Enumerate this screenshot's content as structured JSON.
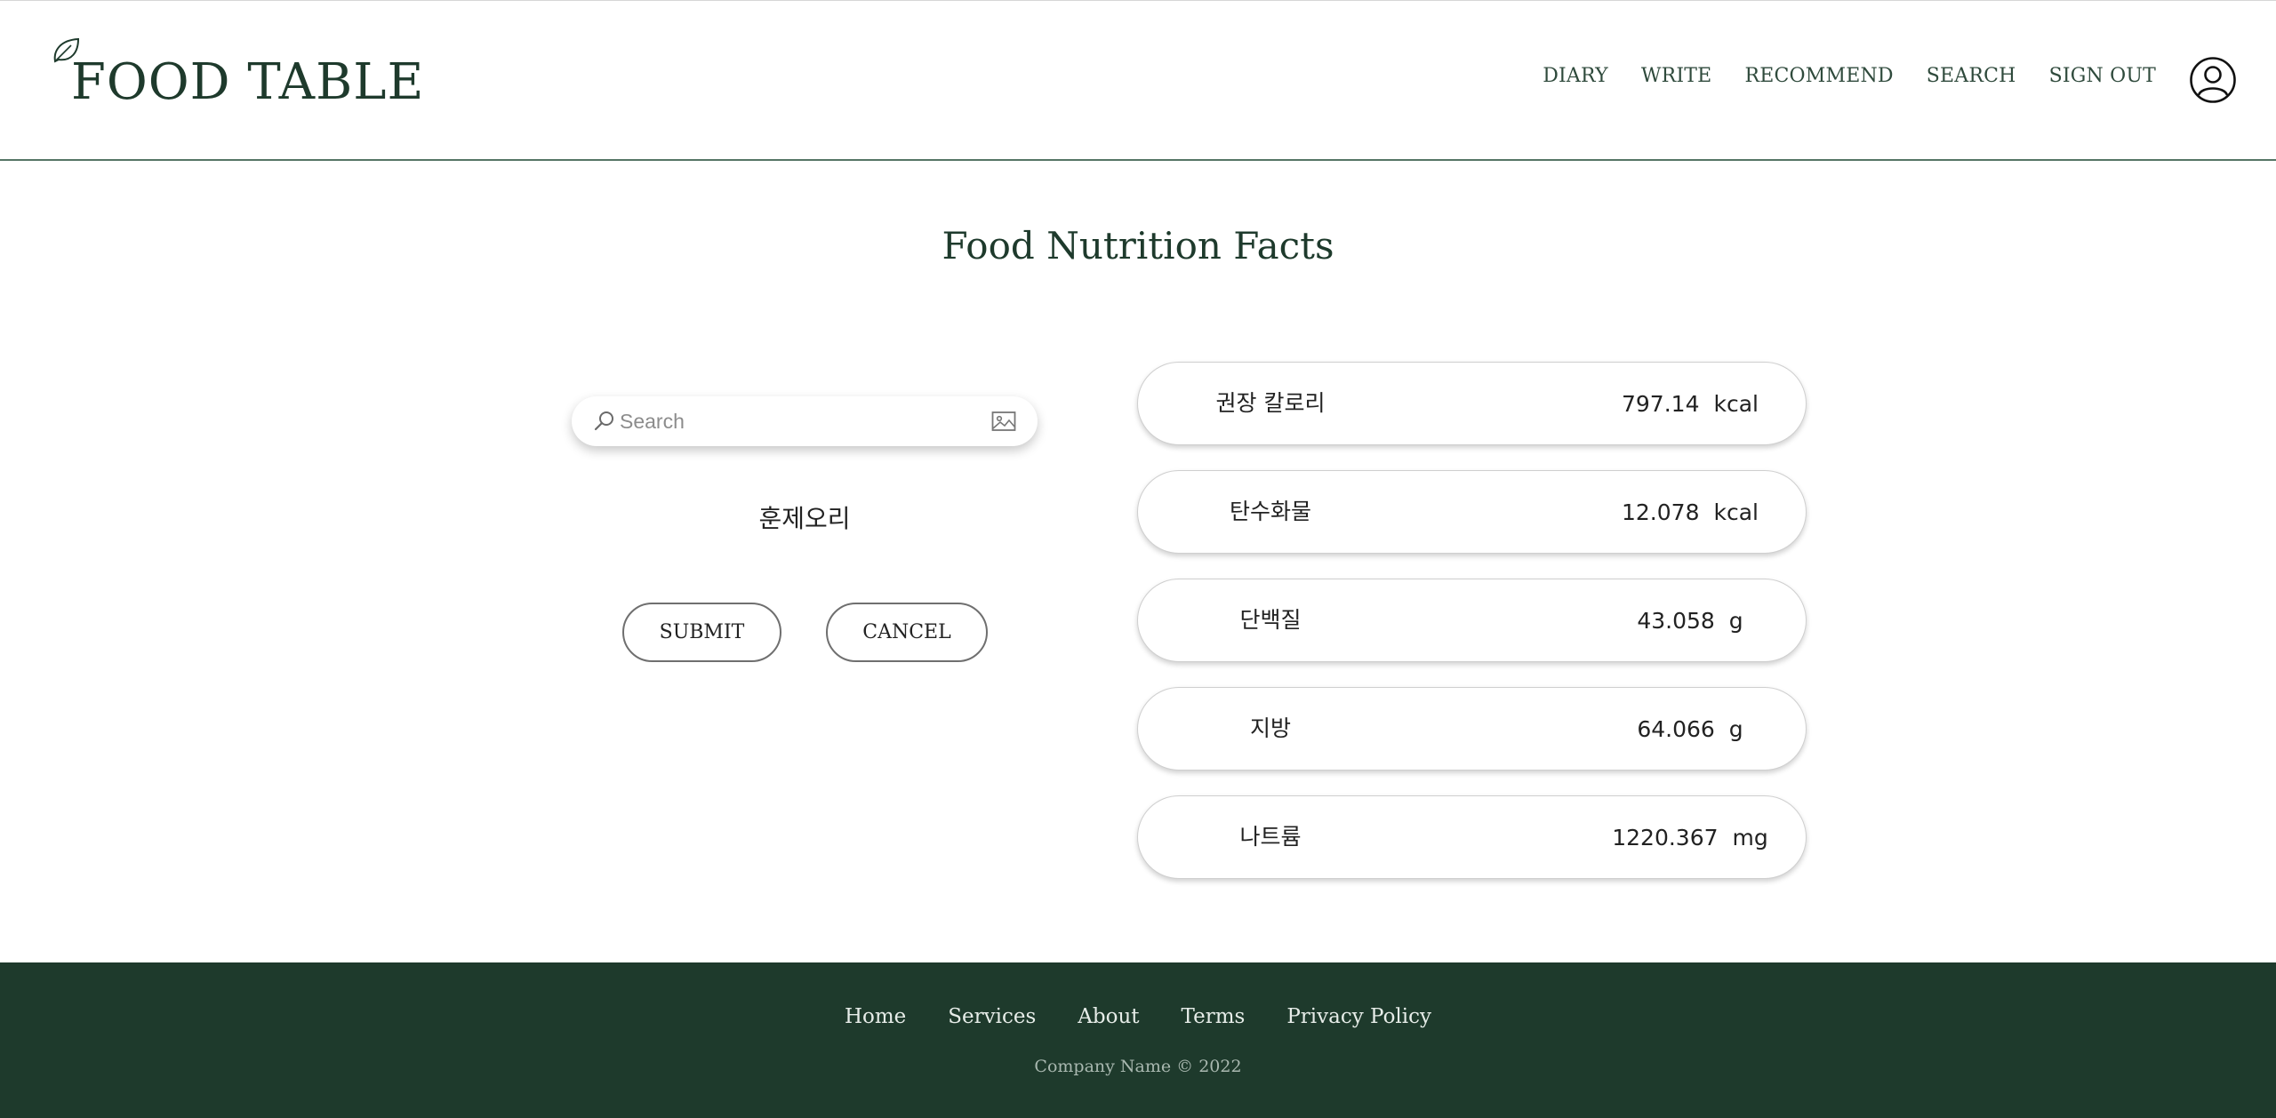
{
  "header": {
    "logo_text": "FOOD TABLE",
    "nav": [
      {
        "label": "DIARY"
      },
      {
        "label": "WRITE"
      },
      {
        "label": "RECOMMEND"
      },
      {
        "label": "SEARCH"
      },
      {
        "label": "SIGN OUT"
      }
    ],
    "account_icon": "user-circle-icon"
  },
  "main": {
    "title": "Food Nutrition Facts",
    "search": {
      "placeholder": "Search",
      "value": "",
      "left_icon": "search-icon",
      "right_icon": "image-icon"
    },
    "food_name": "훈제오리",
    "buttons": {
      "submit": "SUBMIT",
      "cancel": "CANCEL"
    },
    "facts": [
      {
        "label": "권장 칼로리",
        "value": "797.14",
        "unit": "kcal"
      },
      {
        "label": "탄수화물",
        "value": "12.078",
        "unit": "kcal"
      },
      {
        "label": "단백질",
        "value": "43.058",
        "unit": "g"
      },
      {
        "label": "지방",
        "value": "64.066",
        "unit": "g"
      },
      {
        "label": "나트륨",
        "value": "1220.367",
        "unit": "mg"
      }
    ]
  },
  "footer": {
    "links": [
      {
        "label": "Home"
      },
      {
        "label": "Services"
      },
      {
        "label": "About"
      },
      {
        "label": "Terms"
      },
      {
        "label": "Privacy Policy"
      }
    ],
    "copyright": "Company Name © 2022"
  },
  "colors": {
    "brand_green": "#1e3a2c",
    "header_border": "#557565",
    "footer_text": "#e6ece8"
  }
}
